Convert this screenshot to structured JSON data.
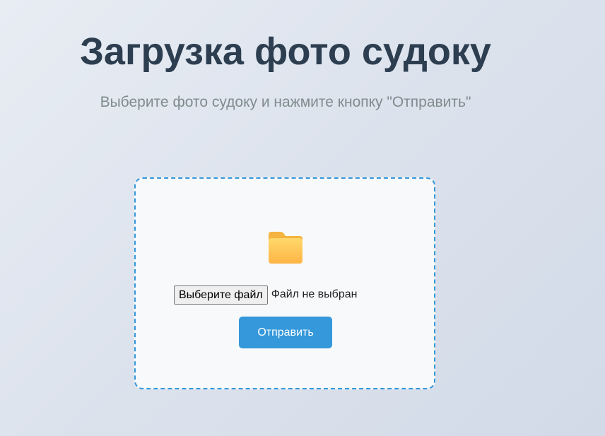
{
  "header": {
    "title": "Загрузка фото судоку",
    "subtitle": "Выберите фото судоку и нажмите кнопку \"Отправить\""
  },
  "upload": {
    "icon": "folder-icon",
    "file_button_label": "Выберите файл",
    "file_status": "Файл не выбран",
    "submit_label": "Отправить"
  },
  "colors": {
    "title": "#2c3e50",
    "subtitle": "#7f8c8d",
    "accent": "#3498db",
    "box_background": "#f7f9fb"
  }
}
